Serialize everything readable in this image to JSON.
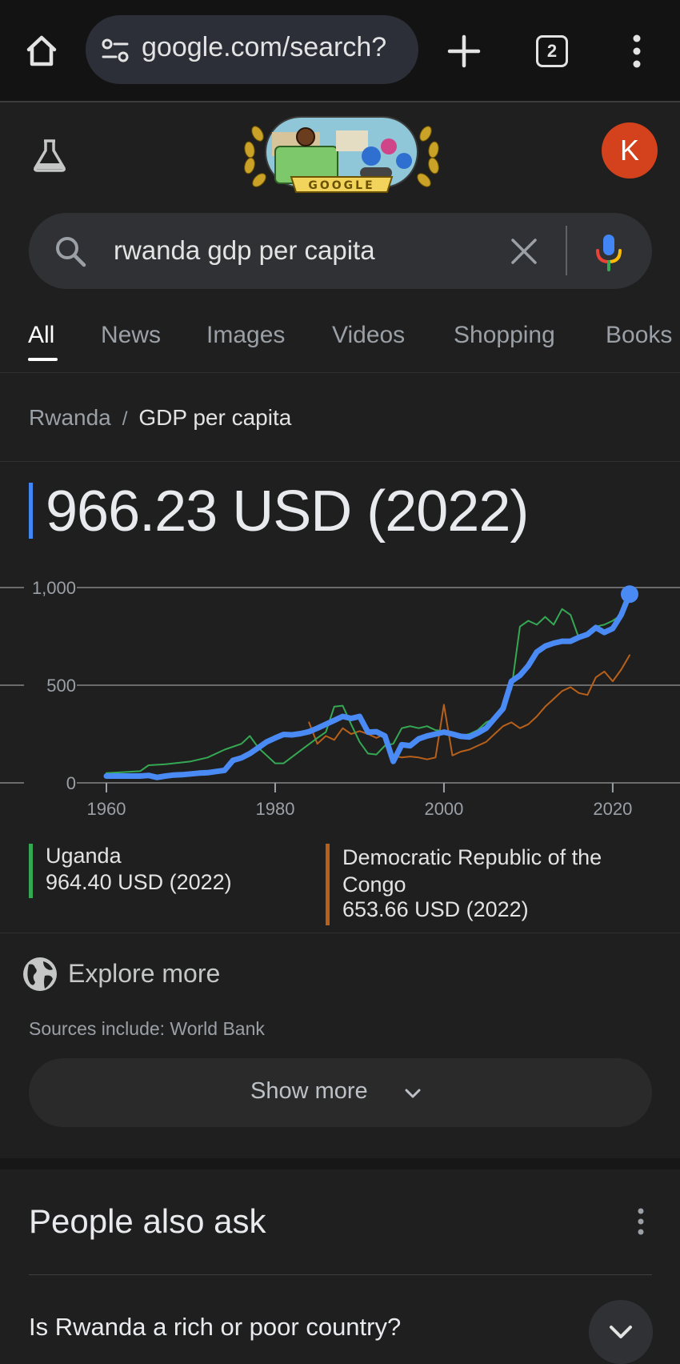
{
  "browser": {
    "url": "google.com/search?",
    "tab_count": "2",
    "icons": [
      "home-icon",
      "tune-icon",
      "plus-icon",
      "tab-switcher-icon",
      "more-vert-icon"
    ]
  },
  "header": {
    "doodle_text": "GOOGLE",
    "avatar_letter": "K",
    "avatar_color": "#d3421c"
  },
  "search": {
    "query": "rwanda gdp per capita"
  },
  "tabs": [
    {
      "label": "All",
      "active": true
    },
    {
      "label": "News"
    },
    {
      "label": "Images"
    },
    {
      "label": "Videos"
    },
    {
      "label": "Shopping"
    },
    {
      "label": "Books"
    }
  ],
  "breadcrumb": {
    "country": "Rwanda",
    "separator": "/",
    "metric": "GDP per capita"
  },
  "headline_value": "966.23 USD (2022)",
  "chart_data": {
    "type": "line",
    "y_ticks": [
      "1,000",
      "500",
      "0"
    ],
    "x_ticks": [
      "1960",
      "1980",
      "2000",
      "2020"
    ],
    "xlim": [
      1960,
      2022
    ],
    "ylim": [
      0,
      1000
    ],
    "grid": "horizontal",
    "series": [
      {
        "name": "Rwanda",
        "color": "#4a8af4",
        "points": [
          [
            1960,
            35
          ],
          [
            1961,
            35
          ],
          [
            1962,
            35
          ],
          [
            1963,
            35
          ],
          [
            1964,
            35
          ],
          [
            1965,
            38
          ],
          [
            1966,
            28
          ],
          [
            1967,
            35
          ],
          [
            1968,
            40
          ],
          [
            1969,
            42
          ],
          [
            1970,
            46
          ],
          [
            1971,
            50
          ],
          [
            1972,
            52
          ],
          [
            1973,
            58
          ],
          [
            1974,
            64
          ],
          [
            1975,
            115
          ],
          [
            1976,
            128
          ],
          [
            1977,
            150
          ],
          [
            1978,
            180
          ],
          [
            1979,
            210
          ],
          [
            1980,
            230
          ],
          [
            1981,
            248
          ],
          [
            1982,
            246
          ],
          [
            1983,
            252
          ],
          [
            1984,
            262
          ],
          [
            1985,
            280
          ],
          [
            1986,
            300
          ],
          [
            1987,
            320
          ],
          [
            1988,
            340
          ],
          [
            1989,
            330
          ],
          [
            1990,
            340
          ],
          [
            1991,
            260
          ],
          [
            1992,
            262
          ],
          [
            1993,
            240
          ],
          [
            1994,
            110
          ],
          [
            1995,
            195
          ],
          [
            1996,
            190
          ],
          [
            1997,
            225
          ],
          [
            1998,
            240
          ],
          [
            1999,
            250
          ],
          [
            2000,
            260
          ],
          [
            2001,
            250
          ],
          [
            2002,
            238
          ],
          [
            2003,
            235
          ],
          [
            2004,
            255
          ],
          [
            2005,
            280
          ],
          [
            2006,
            330
          ],
          [
            2007,
            380
          ],
          [
            2008,
            520
          ],
          [
            2009,
            550
          ],
          [
            2010,
            600
          ],
          [
            2011,
            670
          ],
          [
            2012,
            700
          ],
          [
            2013,
            715
          ],
          [
            2014,
            725
          ],
          [
            2015,
            725
          ],
          [
            2016,
            745
          ],
          [
            2017,
            760
          ],
          [
            2018,
            795
          ],
          [
            2019,
            770
          ],
          [
            2020,
            790
          ],
          [
            2021,
            860
          ],
          [
            2022,
            966.23
          ]
        ]
      },
      {
        "name": "Uganda",
        "value_label": "964.40 USD (2022)",
        "color": "#34a853",
        "points": [
          [
            1960,
            50
          ],
          [
            1962,
            55
          ],
          [
            1964,
            60
          ],
          [
            1965,
            90
          ],
          [
            1967,
            95
          ],
          [
            1970,
            110
          ],
          [
            1972,
            130
          ],
          [
            1974,
            170
          ],
          [
            1976,
            200
          ],
          [
            1977,
            240
          ],
          [
            1978,
            180
          ],
          [
            1980,
            100
          ],
          [
            1981,
            100
          ],
          [
            1983,
            165
          ],
          [
            1985,
            230
          ],
          [
            1986,
            260
          ],
          [
            1987,
            390
          ],
          [
            1988,
            395
          ],
          [
            1989,
            300
          ],
          [
            1990,
            210
          ],
          [
            1991,
            150
          ],
          [
            1992,
            145
          ],
          [
            1993,
            190
          ],
          [
            1994,
            200
          ],
          [
            1995,
            280
          ],
          [
            1996,
            290
          ],
          [
            1997,
            280
          ],
          [
            1998,
            290
          ],
          [
            1999,
            270
          ],
          [
            2000,
            265
          ],
          [
            2001,
            240
          ],
          [
            2002,
            240
          ],
          [
            2003,
            250
          ],
          [
            2004,
            270
          ],
          [
            2005,
            310
          ],
          [
            2006,
            330
          ],
          [
            2007,
            400
          ],
          [
            2008,
            480
          ],
          [
            2009,
            800
          ],
          [
            2010,
            830
          ],
          [
            2011,
            810
          ],
          [
            2012,
            850
          ],
          [
            2013,
            810
          ],
          [
            2014,
            890
          ],
          [
            2015,
            860
          ],
          [
            2016,
            740
          ],
          [
            2017,
            760
          ],
          [
            2018,
            800
          ],
          [
            2019,
            810
          ],
          [
            2020,
            830
          ],
          [
            2021,
            860
          ],
          [
            2022,
            964.4
          ]
        ]
      },
      {
        "name": "Democratic Republic of the Congo",
        "value_label": "653.66 USD (2022)",
        "color": "#b8601a",
        "points": [
          [
            1984,
            310
          ],
          [
            1985,
            200
          ],
          [
            1986,
            240
          ],
          [
            1987,
            220
          ],
          [
            1988,
            280
          ],
          [
            1989,
            250
          ],
          [
            1990,
            265
          ],
          [
            1991,
            250
          ],
          [
            1992,
            230
          ],
          [
            1993,
            250
          ],
          [
            1994,
            140
          ],
          [
            1995,
            130
          ],
          [
            1996,
            135
          ],
          [
            1997,
            130
          ],
          [
            1998,
            120
          ],
          [
            1999,
            130
          ],
          [
            2000,
            400
          ],
          [
            2001,
            140
          ],
          [
            2002,
            160
          ],
          [
            2003,
            170
          ],
          [
            2004,
            190
          ],
          [
            2005,
            210
          ],
          [
            2006,
            250
          ],
          [
            2007,
            290
          ],
          [
            2008,
            310
          ],
          [
            2009,
            280
          ],
          [
            2010,
            300
          ],
          [
            2011,
            340
          ],
          [
            2012,
            390
          ],
          [
            2013,
            430
          ],
          [
            2014,
            470
          ],
          [
            2015,
            490
          ],
          [
            2016,
            460
          ],
          [
            2017,
            450
          ],
          [
            2018,
            540
          ],
          [
            2019,
            570
          ],
          [
            2020,
            520
          ],
          [
            2021,
            580
          ],
          [
            2022,
            653.66
          ]
        ]
      }
    ]
  },
  "explore": {
    "label": "Explore more",
    "sources": "Sources include: World Bank",
    "show_more": "Show more"
  },
  "people_also_ask": {
    "title": "People also ask",
    "questions": [
      "Is Rwanda a rich or poor country?"
    ]
  }
}
